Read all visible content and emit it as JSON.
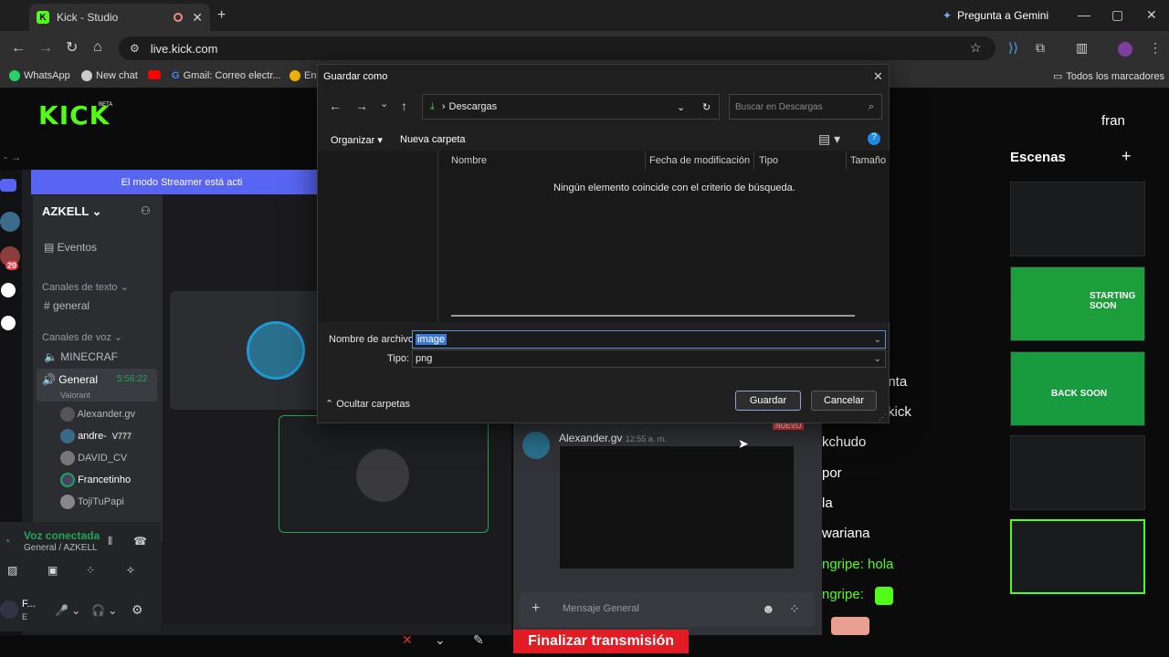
{
  "browser": {
    "tab_title": "Kick - Studio",
    "url": "live.kick.com",
    "gemini": "Pregunta a Gemini",
    "bookmarks": [
      "WhatsApp",
      "New chat",
      "Gmail: Correo electr...",
      "En"
    ],
    "all_bookmarks": "Todos los marcadores"
  },
  "kick": {
    "logo": "KICK",
    "beta": "BETA",
    "finalize": "Finalizar transmisión",
    "user": "fran"
  },
  "discord": {
    "streamer_banner": "El modo Streamer está acti",
    "server": "AZKELL",
    "events": "Eventos",
    "text_channels": "Canales de texto",
    "general": "general",
    "voice_channels": "Canales de voz",
    "minecraft": "MINECRAF",
    "voice_general": "General",
    "voice_time": "5:56:22",
    "voice_game": "Valorant",
    "members": [
      "Alexander.gv",
      "andre-",
      "DAVID_CV",
      "Francetinho",
      "TojiTuPapi"
    ],
    "badge": "V777",
    "voice_connected": "Voz conectada",
    "voice_channel": "General / AZKELL",
    "self_user": "F...",
    "self_status": "E",
    "server_badge": "20",
    "message_author": "Alexander.gv",
    "message_time": "12:55 a. m.",
    "new_label": "NUEVO",
    "message_placeholder": "Mensaje General"
  },
  "scenes": {
    "title": "Escenas",
    "starting": "STARTING SOON",
    "back": "BACK SOON"
  },
  "chat": [
    "enta",
    "kick",
    "kchudo",
    "por",
    "la",
    "wariana",
    "ngripe: hola",
    "ngripe:"
  ],
  "dialog": {
    "title": "Guardar como",
    "path": "Descargas",
    "search_placeholder": "Buscar en Descargas",
    "organize": "Organizar",
    "new_folder": "Nueva carpeta",
    "col_name": "Nombre",
    "col_date": "Fecha de modificación",
    "col_type": "Tipo",
    "col_size": "Tamaño",
    "empty": "Ningún elemento coincide con el criterio de búsqueda.",
    "filename_label": "Nombre de archivo:",
    "filename": "image",
    "type_label": "Tipo:",
    "type_value": "png",
    "hide_folders": "Ocultar carpetas",
    "save": "Guardar",
    "cancel": "Cancelar"
  }
}
